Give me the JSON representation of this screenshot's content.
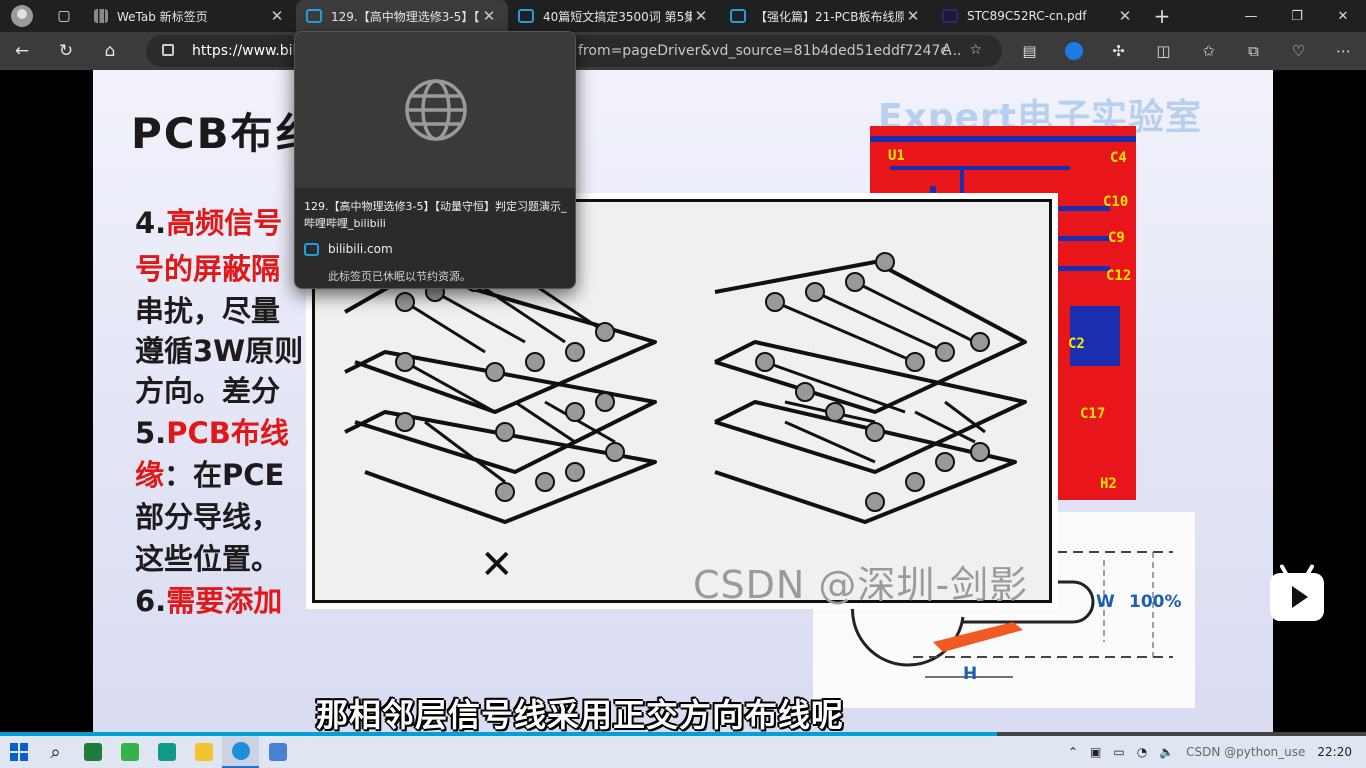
{
  "tabs": [
    {
      "title": "WeTab 新标签页",
      "icon": "wetab-icon",
      "active": false
    },
    {
      "title": "129.【高中物理选修3-5】【",
      "icon": "bilibili-icon",
      "active": true
    },
    {
      "title": "40篇短文搞定3500词 第5集",
      "icon": "bilibili-icon",
      "active": false
    },
    {
      "title": "【强化篇】21-PCB板布线原",
      "icon": "bilibili-icon",
      "active": false
    },
    {
      "title": "STC89C52RC-cn.pdf",
      "icon": "pdf-icon",
      "active": false
    }
  ],
  "address": {
    "prefix": "https://www.bilib",
    "tail": "from=pageDriver&vd_source=81b4ded51eddf7247c..."
  },
  "preview": {
    "title": "129.【高中物理选修3-5】【动量守恒】判定习题演示_哔哩哔哩_bilibili",
    "site": "bilibili.com",
    "note": "此标签页已休眠以节约资源。"
  },
  "slide": {
    "title": "PCB布纟",
    "watermark": "Expert电子实验室",
    "lines": [
      {
        "num": "4.",
        "red": "高频信号",
        "rest": ""
      },
      {
        "num": "",
        "red": "号的屏蔽隔",
        "rest": ""
      },
      {
        "num": "",
        "red": "",
        "rest": "串扰，尽量"
      },
      {
        "num": "",
        "red": "",
        "rest": "遵循3W原则"
      },
      {
        "num": "",
        "red": "",
        "rest": "方向。差分"
      },
      {
        "num": "5.",
        "red": "PCB布线",
        "rest": ""
      },
      {
        "num": "",
        "red": "缘",
        "rest": "：在PCE"
      },
      {
        "num": "",
        "red": "",
        "rest": "部分导线，"
      },
      {
        "num": "",
        "red": "",
        "rest": "这些位置。"
      },
      {
        "num": "6.",
        "red": "需要添加",
        "rest": ""
      }
    ],
    "pcb_labels": [
      "U1",
      "C4",
      "C10",
      "C9",
      "C12",
      "C2",
      "C17",
      "H2"
    ],
    "diagram2": {
      "w": "W",
      "pct": "100%",
      "h": "H"
    },
    "figure": {
      "mark": "✕",
      "watermark": "CSDN @深圳-剑影"
    }
  },
  "subtitle": "那相邻层信号线采用正交方向布线呢",
  "progress_percent": 73,
  "taskbar": {
    "tray_text": "CSDN @python_use",
    "time": "22:20"
  }
}
